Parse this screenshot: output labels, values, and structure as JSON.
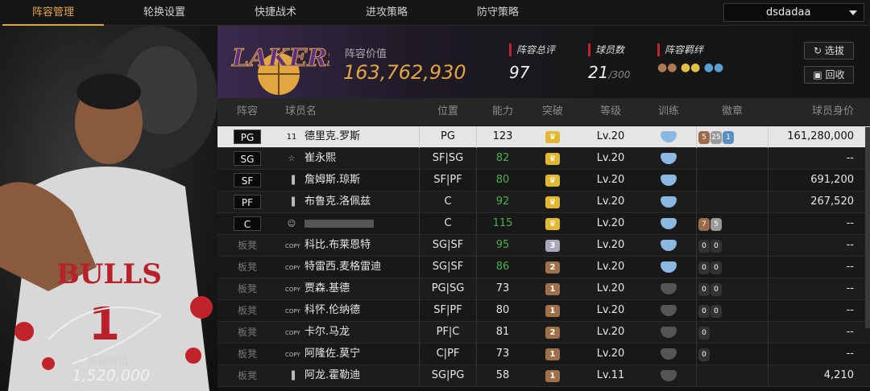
{
  "nav": {
    "tabs": [
      "阵容管理",
      "轮换设置",
      "快捷战术",
      "进攻策略",
      "防守策略"
    ],
    "active": 0,
    "account": "dsdadaa"
  },
  "player_card": {
    "value_label": "阵容价值",
    "value": "1,520,000"
  },
  "team": {
    "value_label": "阵容价值",
    "value": "163,762,930",
    "rating_label": "阵容总评",
    "rating": "97",
    "count_label": "球员数",
    "count": "21",
    "count_max": "/300",
    "bond_label": "阵容羁绊",
    "select_btn": "选拔",
    "back_btn": "回收"
  },
  "columns": [
    "阵容",
    "球员名",
    "位置",
    "能力",
    "突破",
    "等级",
    "训练",
    "徽章",
    "球员身价"
  ],
  "colors": {
    "accent": "#e2a640",
    "green": "#4caf50",
    "red": "#c0242a"
  },
  "rows": [
    {
      "slot": "PG",
      "starter": true,
      "icon": "number-11-icon",
      "name": "德里克.罗斯",
      "pos": "PG",
      "ability": "123",
      "green": false,
      "break": "gold",
      "level": "Lv.20",
      "train": "blue",
      "badges": [
        {
          "c": "#9a6a4a",
          "t": "5"
        },
        {
          "c": "#9a9a9a",
          "t": "25"
        },
        {
          "c": "#5a8fc4",
          "t": "1"
        }
      ],
      "value": "161,280,000"
    },
    {
      "slot": "SG",
      "starter": true,
      "icon": "star-icon",
      "name": "崔永熙",
      "pos": "SF|SG",
      "ability": "82",
      "green": true,
      "break": "gold",
      "level": "Lv.20",
      "train": "blue",
      "badges": [],
      "value": "--"
    },
    {
      "slot": "SF",
      "starter": true,
      "icon": "bars-icon",
      "name": "詹姆斯.琼斯",
      "pos": "SF|PF",
      "ability": "80",
      "green": true,
      "break": "gold",
      "level": "Lv.20",
      "train": "blue",
      "badges": [],
      "value": "691,200"
    },
    {
      "slot": "PF",
      "starter": true,
      "icon": "bars-icon",
      "name": "布鲁克.洛佩兹",
      "pos": "C",
      "ability": "92",
      "green": true,
      "break": "gold",
      "level": "Lv.20",
      "train": "blue",
      "badges": [],
      "value": "267,520"
    },
    {
      "slot": "C",
      "starter": true,
      "icon": "person-icon",
      "name": "",
      "pos": "C",
      "ability": "115",
      "green": true,
      "break": "gold",
      "level": "Lv.20",
      "train": "blue",
      "badges": [
        {
          "c": "#9a6a4a",
          "t": "7"
        },
        {
          "c": "#9a9a9a",
          "t": "5"
        }
      ],
      "value": "--"
    },
    {
      "slot": "板凳",
      "starter": false,
      "icon": "copy-icon",
      "name": "科比.布莱恩特",
      "pos": "SG|SF",
      "ability": "95",
      "green": true,
      "break": "silver",
      "break_n": "3",
      "level": "Lv.20",
      "train": "blue",
      "badges": [
        {
          "c": "#333",
          "t": "0"
        },
        {
          "c": "#333",
          "t": "0"
        }
      ],
      "value": "--"
    },
    {
      "slot": "板凳",
      "starter": false,
      "icon": "copy-icon",
      "name": "特雷西.麦格雷迪",
      "pos": "SG|SF",
      "ability": "86",
      "green": true,
      "break": "bronze",
      "break_n": "2",
      "level": "Lv.20",
      "train": "blue",
      "badges": [
        {
          "c": "#333",
          "t": "0"
        },
        {
          "c": "#333",
          "t": "0"
        }
      ],
      "value": "--"
    },
    {
      "slot": "板凳",
      "starter": false,
      "icon": "copy-icon",
      "name": "贾森.基德",
      "pos": "PG|SG",
      "ability": "73",
      "green": false,
      "break": "bronze",
      "break_n": "1",
      "level": "Lv.20",
      "train": "grey",
      "badges": [
        {
          "c": "#333",
          "t": "0"
        },
        {
          "c": "#333",
          "t": "0"
        }
      ],
      "value": "--"
    },
    {
      "slot": "板凳",
      "starter": false,
      "icon": "copy-icon",
      "name": "科怀.伦纳德",
      "pos": "SF|PF",
      "ability": "80",
      "green": false,
      "break": "bronze",
      "break_n": "1",
      "level": "Lv.20",
      "train": "grey",
      "badges": [
        {
          "c": "#333",
          "t": "0"
        },
        {
          "c": "#333",
          "t": "0"
        }
      ],
      "value": "--"
    },
    {
      "slot": "板凳",
      "starter": false,
      "icon": "copy-icon",
      "name": "卡尔.马龙",
      "pos": "PF|C",
      "ability": "81",
      "green": false,
      "break": "bronze",
      "break_n": "2",
      "level": "Lv.20",
      "train": "grey",
      "badges": [
        {
          "c": "#333",
          "t": "0"
        }
      ],
      "value": "--"
    },
    {
      "slot": "板凳",
      "starter": false,
      "icon": "copy-icon",
      "name": "阿隆佐.莫宁",
      "pos": "C|PF",
      "ability": "73",
      "green": false,
      "break": "bronze",
      "break_n": "1",
      "level": "Lv.20",
      "train": "grey",
      "badges": [
        {
          "c": "#333",
          "t": "0"
        }
      ],
      "value": "--"
    },
    {
      "slot": "板凳",
      "starter": false,
      "icon": "bars-icon",
      "name": "阿龙.霍勒迪",
      "pos": "SG|PG",
      "ability": "58",
      "green": false,
      "break": "bronze",
      "break_n": "1",
      "level": "Lv.11",
      "train": "grey",
      "badges": [],
      "value": "4,210"
    }
  ]
}
